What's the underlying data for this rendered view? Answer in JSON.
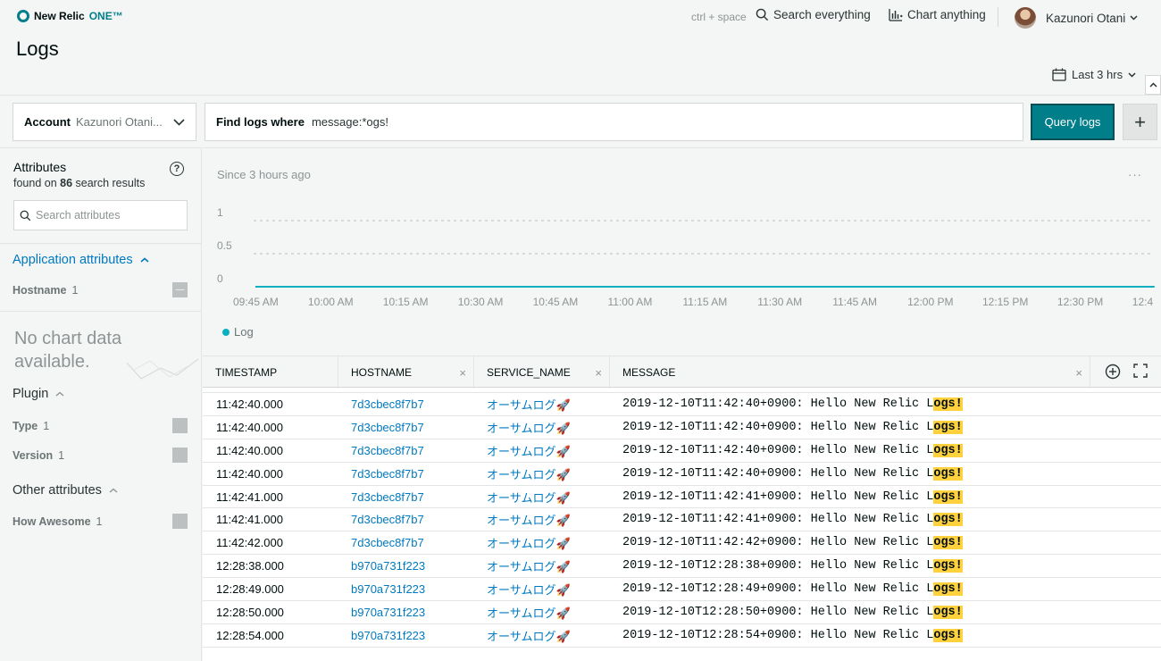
{
  "topbar": {
    "brand": "New Relic",
    "brand_one": "ONE™",
    "shortcut": "ctrl + space",
    "search_label": "Search everything",
    "chart_label": "Chart anything",
    "user_name": "Kazunori Otani"
  },
  "page": {
    "title": "Logs"
  },
  "timepicker": {
    "label": "Last 3 hrs"
  },
  "query": {
    "account_label": "Account",
    "account_value": "Kazunori Otani...",
    "find_label": "Find logs where",
    "query_text": "message:*ogs!",
    "submit_label": "Query logs"
  },
  "sidebar": {
    "title": "Attributes",
    "found_prefix": "found on ",
    "found_count": "86",
    "found_suffix": " search results",
    "search_placeholder": "Search attributes",
    "app_section": "Application attributes",
    "hostname": {
      "name": "Hostname",
      "count": "1"
    },
    "no_chart": "No chart data available.",
    "plugin_section": "Plugin",
    "plugin_items": [
      {
        "name": "Type",
        "count": "1"
      },
      {
        "name": "Version",
        "count": "1"
      }
    ],
    "other_section": "Other attributes",
    "other_items": [
      {
        "name": "How Awesome",
        "count": "1"
      }
    ]
  },
  "chart": {
    "since": "Since 3 hours ago",
    "legend": "Log",
    "accent": "#0ab0bf"
  },
  "chart_data": {
    "type": "line",
    "x": [
      "09:45 AM",
      "10:00 AM",
      "10:15 AM",
      "10:30 AM",
      "10:45 AM",
      "11:00 AM",
      "11:15 AM",
      "11:30 AM",
      "11:45 AM",
      "12:00 PM",
      "12:15 PM",
      "12:30 PM",
      "12:4"
    ],
    "series": [
      {
        "name": "Log",
        "values": [
          0,
          0,
          0,
          0,
          0,
          0,
          0,
          0,
          0,
          0,
          0,
          0,
          0
        ]
      }
    ],
    "y_ticks": [
      "1",
      "0.5",
      "0"
    ],
    "ylim": [
      0,
      1
    ],
    "grid": true,
    "legend": "bottom-left"
  },
  "table": {
    "columns": [
      "TIMESTAMP",
      "HOSTNAME",
      "SERVICE_NAME",
      "MESSAGE"
    ],
    "rows": [
      {
        "ts": "11:42:40.000",
        "host": "7d3cbec8f7b7",
        "svc": "オーサムログ🚀",
        "msg": "2019-12-10T11:42:40+0900: Hello New Relic L",
        "hl": "ogs!"
      },
      {
        "ts": "11:42:40.000",
        "host": "7d3cbec8f7b7",
        "svc": "オーサムログ🚀",
        "msg": "2019-12-10T11:42:40+0900: Hello New Relic L",
        "hl": "ogs!"
      },
      {
        "ts": "11:42:40.000",
        "host": "7d3cbec8f7b7",
        "svc": "オーサムログ🚀",
        "msg": "2019-12-10T11:42:40+0900: Hello New Relic L",
        "hl": "ogs!"
      },
      {
        "ts": "11:42:40.000",
        "host": "7d3cbec8f7b7",
        "svc": "オーサムログ🚀",
        "msg": "2019-12-10T11:42:40+0900: Hello New Relic L",
        "hl": "ogs!"
      },
      {
        "ts": "11:42:41.000",
        "host": "7d3cbec8f7b7",
        "svc": "オーサムログ🚀",
        "msg": "2019-12-10T11:42:41+0900: Hello New Relic L",
        "hl": "ogs!"
      },
      {
        "ts": "11:42:41.000",
        "host": "7d3cbec8f7b7",
        "svc": "オーサムログ🚀",
        "msg": "2019-12-10T11:42:41+0900: Hello New Relic L",
        "hl": "ogs!"
      },
      {
        "ts": "11:42:42.000",
        "host": "7d3cbec8f7b7",
        "svc": "オーサムログ🚀",
        "msg": "2019-12-10T11:42:42+0900: Hello New Relic L",
        "hl": "ogs!"
      },
      {
        "ts": "12:28:38.000",
        "host": "b970a731f223",
        "svc": "オーサムログ🚀",
        "msg": "2019-12-10T12:28:38+0900: Hello New Relic L",
        "hl": "ogs!"
      },
      {
        "ts": "12:28:49.000",
        "host": "b970a731f223",
        "svc": "オーサムログ🚀",
        "msg": "2019-12-10T12:28:49+0900: Hello New Relic L",
        "hl": "ogs!"
      },
      {
        "ts": "12:28:50.000",
        "host": "b970a731f223",
        "svc": "オーサムログ🚀",
        "msg": "2019-12-10T12:28:50+0900: Hello New Relic L",
        "hl": "ogs!"
      },
      {
        "ts": "12:28:54.000",
        "host": "b970a731f223",
        "svc": "オーサムログ🚀",
        "msg": "2019-12-10T12:28:54+0900: Hello New Relic L",
        "hl": "ogs!"
      }
    ]
  }
}
